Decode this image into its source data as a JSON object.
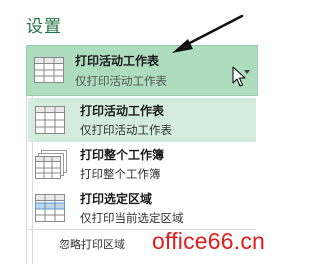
{
  "section": {
    "title": "设置"
  },
  "print_scope": {
    "selected_label": "打印活动工作表",
    "selected_description": "仅打印活动工作表",
    "options": [
      {
        "label": "打印活动工作表",
        "description": "仅打印活动工作表",
        "icon": "active-sheet-icon",
        "selected": true
      },
      {
        "label": "打印整个工作簿",
        "description": "打印整个工作簿",
        "icon": "workbook-icon",
        "selected": false
      },
      {
        "label": "打印选定区域",
        "description": "仅打印当前选定区域",
        "icon": "selection-icon",
        "selected": false
      }
    ],
    "ignore_print_area": "忽略打印区域"
  },
  "watermark": {
    "text": "office66.cn"
  },
  "colors": {
    "accent": "#217346",
    "selected_bg": "#aedcbe",
    "hover_bg": "#d4ecde",
    "watermark": "#e31b1b"
  }
}
